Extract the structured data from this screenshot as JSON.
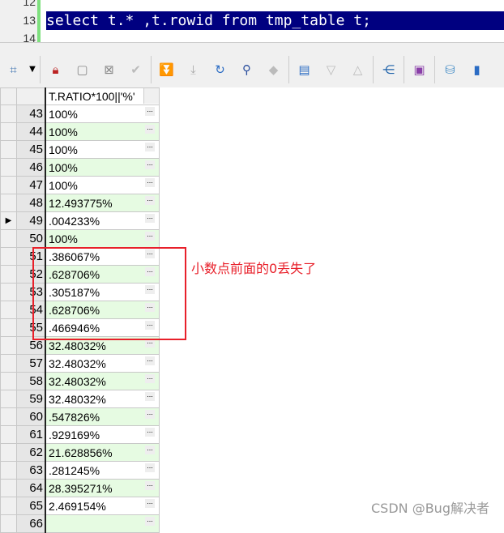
{
  "editor": {
    "lines": [
      "12",
      "13",
      "14"
    ],
    "selected_sql": "select t.* ,t.rowid from tmp_table t;"
  },
  "toolbar": {
    "icons": [
      "select-mode-icon",
      "dropdown-arrow-icon",
      "lock-icon",
      "new-record-icon",
      "delete-record-icon",
      "post-check-icon",
      "fetch-next-icon",
      "fetch-all-icon",
      "refresh-icon",
      "find-icon",
      "clear-icon",
      "record-view-icon",
      "sort-desc-icon",
      "sort-asc-icon",
      "query-tree-icon",
      "save-icon",
      "export-icon",
      "chart-icon"
    ]
  },
  "grid": {
    "column_header": "T.RATIO*100||'%'",
    "current_row": "49",
    "rows": [
      {
        "n": "43",
        "v": "100%"
      },
      {
        "n": "44",
        "v": "100%"
      },
      {
        "n": "45",
        "v": "100%"
      },
      {
        "n": "46",
        "v": "100%"
      },
      {
        "n": "47",
        "v": "100%"
      },
      {
        "n": "48",
        "v": "12.493775%"
      },
      {
        "n": "49",
        "v": ".004233%"
      },
      {
        "n": "50",
        "v": "100%"
      },
      {
        "n": "51",
        "v": ".386067%"
      },
      {
        "n": "52",
        "v": ".628706%"
      },
      {
        "n": "53",
        "v": ".305187%"
      },
      {
        "n": "54",
        "v": ".628706%"
      },
      {
        "n": "55",
        "v": ".466946%"
      },
      {
        "n": "56",
        "v": "32.48032%"
      },
      {
        "n": "57",
        "v": "32.48032%"
      },
      {
        "n": "58",
        "v": "32.48032%"
      },
      {
        "n": "59",
        "v": "32.48032%"
      },
      {
        "n": "60",
        "v": ".547826%"
      },
      {
        "n": "61",
        "v": ".929169%"
      },
      {
        "n": "62",
        "v": "21.628856%"
      },
      {
        "n": "63",
        "v": ".281245%"
      },
      {
        "n": "64",
        "v": "28.395271%"
      },
      {
        "n": "65",
        "v": "2.469154%"
      },
      {
        "n": "66",
        "v": ""
      }
    ]
  },
  "annotation": "小数点前面的0丢失了",
  "watermark": "CSDN @Bug解决者"
}
